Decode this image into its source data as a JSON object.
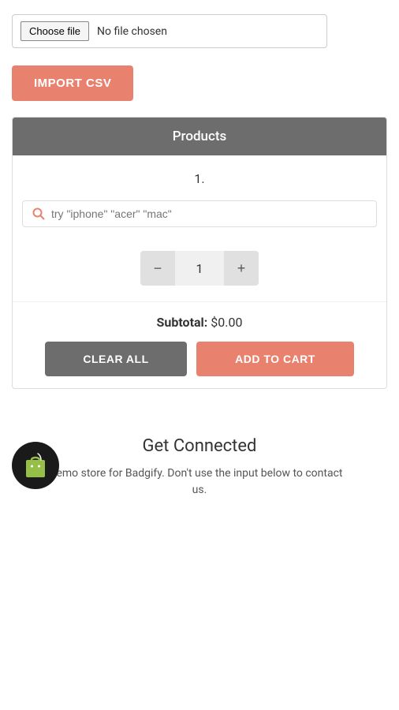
{
  "file_section": {
    "choose_file_label": "Choose file",
    "no_file_label": "No file chosen"
  },
  "import_btn": {
    "label": "IMPORT CSV"
  },
  "products": {
    "header": "Products",
    "item_number": "1.",
    "search_placeholder": "try \"iphone\" \"acer\" \"mac\"",
    "quantity": 1,
    "subtotal_label": "Subtotal:",
    "subtotal_value": "$0.00",
    "clear_all_label": "CLEAR ALL",
    "add_to_cart_label": "ADD TO CART"
  },
  "get_connected": {
    "title": "Get Connected",
    "description": "emo store for Badgify. Don't use the input below to contact us."
  },
  "icons": {
    "search": "🔍",
    "minus": "−",
    "plus": "+"
  }
}
